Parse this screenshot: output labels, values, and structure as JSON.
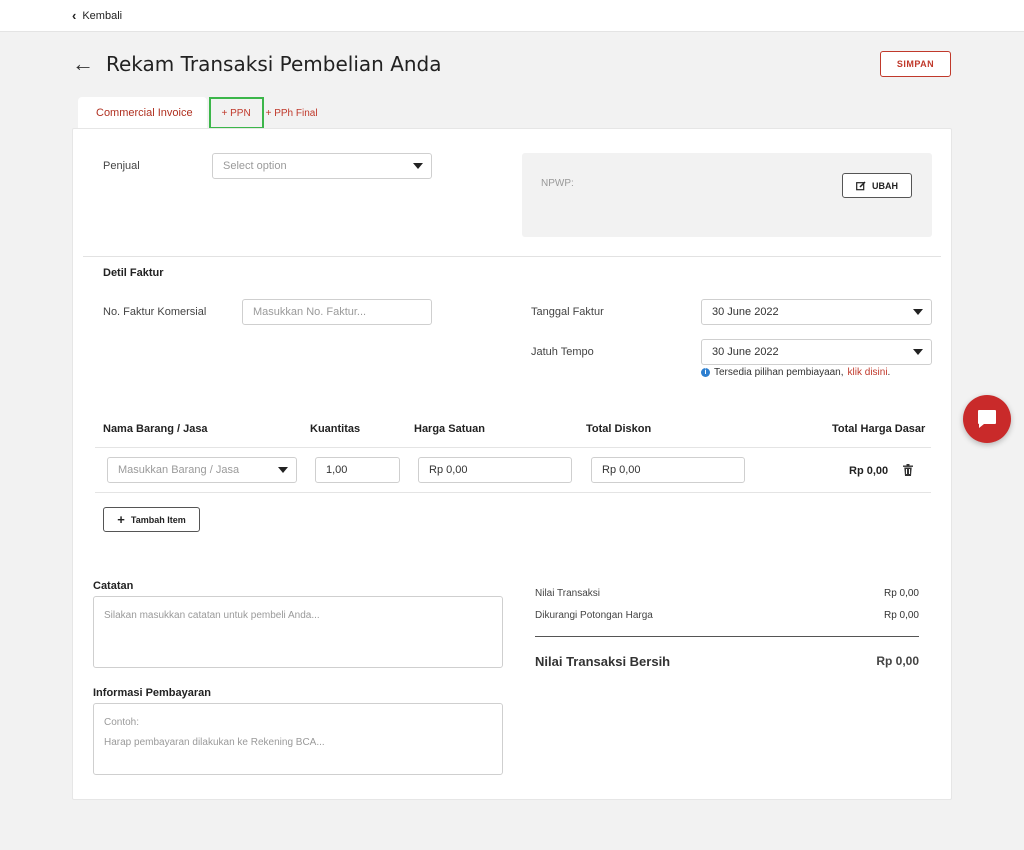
{
  "topbar": {
    "back_label": "Kembali"
  },
  "header": {
    "title": "Rekam Transaksi Pembelian Anda",
    "save_label": "SIMPAN"
  },
  "tabs": [
    {
      "label": "Commercial Invoice"
    },
    {
      "label": "+ PPN"
    },
    {
      "label": "+ PPh Final"
    }
  ],
  "seller": {
    "label": "Penjual",
    "placeholder": "Select option",
    "npwp_label": "NPWP:",
    "change_label": "UBAH"
  },
  "invoice_detail": {
    "section_title": "Detil Faktur",
    "invoice_no_label": "No. Faktur Komersial",
    "invoice_no_placeholder": "Masukkan No. Faktur...",
    "invoice_date_label": "Tanggal Faktur",
    "invoice_date_value": "30 June 2022",
    "due_date_label": "Jatuh Tempo",
    "due_date_value": "30 June 2022",
    "financing_note": "Tersedia pilihan pembiayaan,",
    "financing_link": "klik disini",
    "financing_end": "."
  },
  "items_table": {
    "columns": [
      "Nama Barang / Jasa",
      "Kuantitas",
      "Harga Satuan",
      "Total Diskon",
      "Total Harga Dasar"
    ],
    "rows": [
      {
        "item_placeholder": "Masukkan Barang / Jasa",
        "quantity": "1,00",
        "unit_price": "Rp 0,00",
        "discount": "Rp 0,00",
        "base_total": "Rp 0,00"
      }
    ],
    "add_item_label": "Tambah Item"
  },
  "notes": {
    "label": "Catatan",
    "placeholder": "Silakan masukkan catatan untuk pembeli Anda..."
  },
  "payment_info": {
    "label": "Informasi Pembayaran",
    "placeholder_line1": "Contoh:",
    "placeholder_line2": "Harap pembayaran dilakukan ke Rekening BCA..."
  },
  "summary": {
    "transaction_value_label": "Nilai Transaksi",
    "transaction_value": "Rp 0,00",
    "discount_label": "Dikurangi Potongan Harga",
    "discount_value": "Rp 0,00",
    "net_label": "Nilai Transaksi Bersih",
    "net_value": "Rp 0,00"
  },
  "colors": {
    "accent": "#c0392b",
    "highlight_box": "#3cb64a",
    "info": "#2d7fd0",
    "chat_fab": "#c92a2a"
  }
}
